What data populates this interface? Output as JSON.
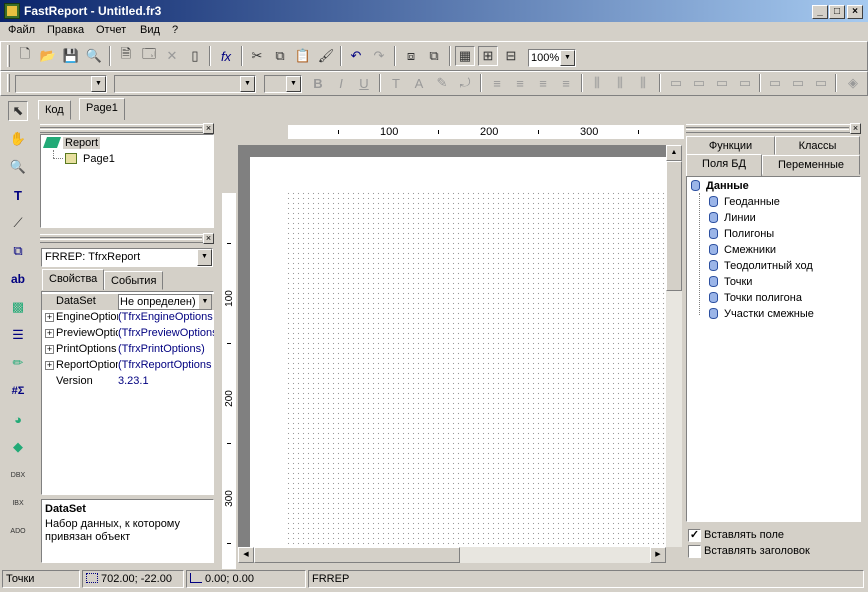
{
  "window": {
    "title": "FastReport - Untitled.fr3"
  },
  "menu": [
    "Файл",
    "Правка",
    "Отчет",
    "Вид",
    "?"
  ],
  "toolbar": {
    "zoom": "100%"
  },
  "doc_tabs": [
    "Код",
    "Page1"
  ],
  "tree": {
    "root": "Report",
    "child": "Page1"
  },
  "inspector": {
    "object": "FRREP: TfrxReport",
    "tabs": [
      "Свойства",
      "События"
    ],
    "props": [
      {
        "name": "DataSet",
        "value": "Не определен)"
      },
      {
        "name": "EngineOptions",
        "value": "(TfrxEngineOptions"
      },
      {
        "name": "PreviewOptions",
        "value": "(TfrxPreviewOptions"
      },
      {
        "name": "PrintOptions",
        "value": "(TfrxPrintOptions)"
      },
      {
        "name": "ReportOptions",
        "value": "(TfrxReportOptions"
      },
      {
        "name": "Version",
        "value": "3.23.1"
      }
    ],
    "help_title": "DataSet",
    "help_text": "Набор данных, к которому привязан объект"
  },
  "ruler": {
    "h": [
      "100",
      "200",
      "300"
    ],
    "v": [
      "100",
      "200",
      "300"
    ]
  },
  "right_panel": {
    "tabs_top": [
      "Функции",
      "Классы"
    ],
    "tabs_bottom": [
      "Поля БД",
      "Переменные"
    ],
    "root": "Данные",
    "items": [
      "Геоданные",
      "Линии",
      "Полигоны",
      "Смежники",
      "Теодолитный ход",
      "Точки",
      "Точки полигона",
      "Участки смежные"
    ],
    "insert_field": "Вставлять поле",
    "insert_header": "Вставлять заголовок"
  },
  "status": {
    "mode": "Точки",
    "pos": "702.00; -22.00",
    "size": "0.00; 0.00",
    "name": "FRREP"
  }
}
